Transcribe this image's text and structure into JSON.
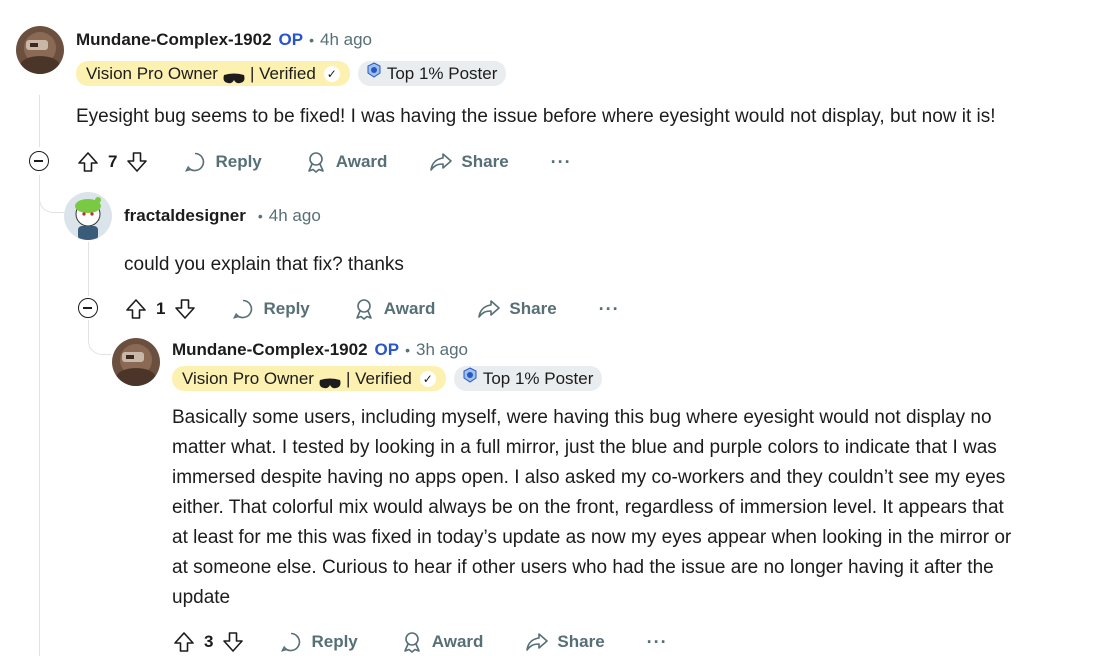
{
  "comments": [
    {
      "username": "Mundane-Complex-1902",
      "op": "OP",
      "separator": "•",
      "time": "4h ago",
      "flair_owner": "Vision Pro Owner",
      "flair_verified": "| Verified",
      "flair_check": "✓",
      "flair_top": "Top 1% Poster",
      "body": "Eyesight bug seems to be fixed! I was having the issue before where eyesight would not display, but now it is!",
      "votes": "7",
      "reply": "Reply",
      "award": "Award",
      "share": "Share",
      "more": "···"
    },
    {
      "username": "fractaldesigner",
      "separator": "•",
      "time": "4h ago",
      "body": "could you explain that fix? thanks",
      "votes": "1",
      "reply": "Reply",
      "award": "Award",
      "share": "Share",
      "more": "···"
    },
    {
      "username": "Mundane-Complex-1902",
      "op": "OP",
      "separator": "•",
      "time": "3h ago",
      "flair_owner": "Vision Pro Owner",
      "flair_verified": "| Verified",
      "flair_check": "✓",
      "flair_top": "Top 1% Poster",
      "body_lines": [
        "Basically some users, including myself, were having this bug where eyesight would not display no",
        "matter what. I tested by looking in a full mirror, just the blue and purple colors to indicate that I was",
        "immersed despite having no apps open. I also asked my co-workers and they couldn’t see my eyes",
        "either. That colorful mix would always be on the front, regardless of immersion level. It appears that",
        "at least for me this was fixed in today’s update as now my eyes appear when looking in the mirror or",
        "at someone else. Curious to hear if other users who had the issue are no longer having it after the",
        "update"
      ],
      "votes": "3",
      "reply": "Reply",
      "award": "Award",
      "share": "Share",
      "more": "···"
    }
  ],
  "colors": {
    "op": "#2a55c9",
    "muted": "#576f76",
    "flair_owner_bg": "#fdf1b1",
    "flair_top_bg": "#eaedef",
    "thread_line": "#dfe3e6"
  }
}
